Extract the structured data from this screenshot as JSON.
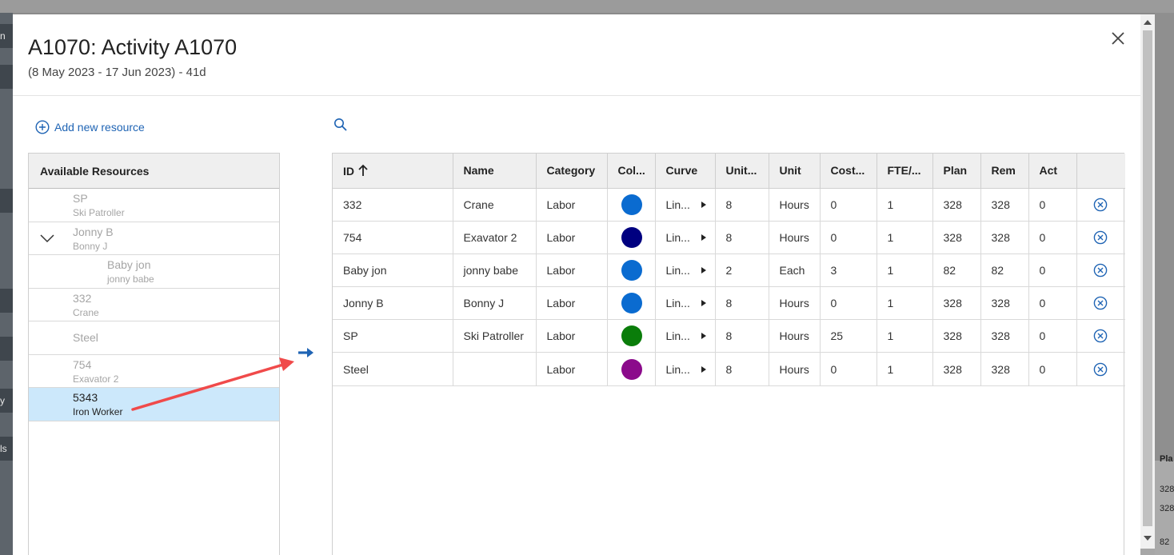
{
  "background": {
    "left_fragments": [
      "n",
      "y",
      "ls"
    ],
    "right_fragments": [
      "Pla",
      "328",
      "328",
      "82"
    ]
  },
  "modal": {
    "title": "A1070: Activity A1070",
    "subtitle": "(8 May 2023 - 17 Jun 2023) - 41d"
  },
  "actions": {
    "add_new_resource": "Add new resource"
  },
  "available": {
    "header": "Available Resources",
    "items": [
      {
        "id": "SP",
        "name": "Ski Patroller",
        "level": 0,
        "expanded": false,
        "selected": false
      },
      {
        "id": "Jonny B",
        "name": "Bonny J",
        "level": 0,
        "expanded": true,
        "selected": false
      },
      {
        "id": "Baby jon",
        "name": "jonny babe",
        "level": 1,
        "expanded": false,
        "selected": false
      },
      {
        "id": "332",
        "name": "Crane",
        "level": 0,
        "expanded": false,
        "selected": false
      },
      {
        "id": "Steel",
        "name": "",
        "level": 0,
        "expanded": false,
        "selected": false
      },
      {
        "id": "754",
        "name": "Exavator 2",
        "level": 0,
        "expanded": false,
        "selected": false
      },
      {
        "id": "5343",
        "name": "Iron Worker",
        "level": 0,
        "expanded": false,
        "selected": true
      }
    ]
  },
  "assigned": {
    "columns": [
      "ID",
      "Name",
      "Category",
      "Col...",
      "Curve",
      "Unit...",
      "Unit",
      "Cost...",
      "FTE/...",
      "Plan",
      "Rem",
      "Act",
      ""
    ],
    "rows": [
      {
        "id": "332",
        "name": "Crane",
        "category": "Labor",
        "color": "#0a6bd0",
        "curve": "Lin...",
        "units": "8",
        "unit": "Hours",
        "cost": "0",
        "fte": "1",
        "plan": "328",
        "rem": "328",
        "act": "0"
      },
      {
        "id": "754",
        "name": "Exavator 2",
        "category": "Labor",
        "color": "#000080",
        "curve": "Lin...",
        "units": "8",
        "unit": "Hours",
        "cost": "0",
        "fte": "1",
        "plan": "328",
        "rem": "328",
        "act": "0"
      },
      {
        "id": "Baby jon",
        "name": "jonny babe",
        "category": "Labor",
        "color": "#0a6bd0",
        "curve": "Lin...",
        "units": "2",
        "unit": "Each",
        "cost": "3",
        "fte": "1",
        "plan": "82",
        "rem": "82",
        "act": "0"
      },
      {
        "id": "Jonny B",
        "name": "Bonny J",
        "category": "Labor",
        "color": "#0a6bd0",
        "curve": "Lin...",
        "units": "8",
        "unit": "Hours",
        "cost": "0",
        "fte": "1",
        "plan": "328",
        "rem": "328",
        "act": "0"
      },
      {
        "id": "SP",
        "name": "Ski Patroller",
        "category": "Labor",
        "color": "#0a7d0a",
        "curve": "Lin...",
        "units": "8",
        "unit": "Hours",
        "cost": "25",
        "fte": "1",
        "plan": "328",
        "rem": "328",
        "act": "0"
      },
      {
        "id": "Steel",
        "name": "",
        "category": "Labor",
        "color": "#8b0a8b",
        "curve": "Lin...",
        "units": "8",
        "unit": "Hours",
        "cost": "0",
        "fte": "1",
        "plan": "328",
        "rem": "328",
        "act": "0"
      }
    ]
  },
  "colors": {
    "accent": "#1f64b4",
    "selection": "#cce8fb",
    "annotation": "#f04a4a"
  },
  "icons": {
    "close": "close-icon",
    "add": "plus-circle-icon",
    "search": "search-icon",
    "move": "arrow-right-icon",
    "remove": "remove-circle-icon",
    "sort": "arrow-up-icon",
    "expand": "chevron-down-icon"
  }
}
